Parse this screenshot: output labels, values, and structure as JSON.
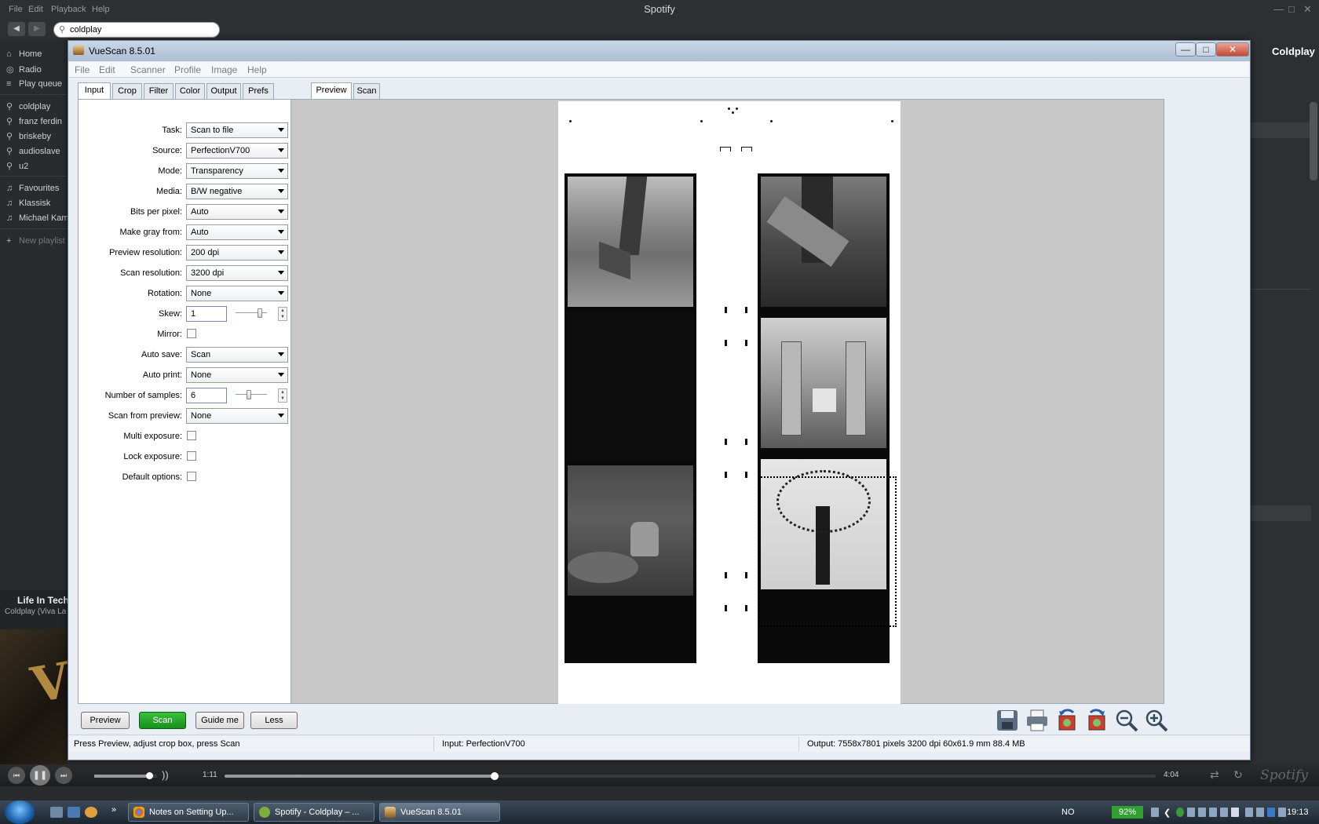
{
  "spotify": {
    "title": "Spotify",
    "menu": [
      "File",
      "Edit",
      "Playback",
      "Help"
    ],
    "search_value": "coldplay",
    "sidebar": {
      "nav": [
        "Home",
        "Radio",
        "Play queue"
      ],
      "searches": [
        "coldplay",
        "franz ferdin",
        "briskeby",
        "audioslave",
        "u2"
      ],
      "playlists": [
        "Favourites",
        "Klassisk",
        "Michael Kam"
      ],
      "new_playlist": "New playlist"
    },
    "now_playing": {
      "title": "Life In Tech",
      "artist": "Coldplay (Viva La",
      "art_text": "VI"
    },
    "artist_header": "Coldplay",
    "player": {
      "elapsed": "1:11",
      "total": "4:04",
      "progress": 0.29,
      "volume": 0.88,
      "logo": "Spotify"
    }
  },
  "vuescan": {
    "title": "VueScan 8.5.01",
    "menu": [
      "File",
      "Edit",
      "Scanner",
      "Profile",
      "Image",
      "Help"
    ],
    "left_tabs": [
      "Input",
      "Crop",
      "Filter",
      "Color",
      "Output",
      "Prefs"
    ],
    "active_left_tab": "Input",
    "right_tabs": [
      "Preview",
      "Scan"
    ],
    "active_right_tab": "Preview",
    "fields": {
      "task": {
        "label": "Task:",
        "value": "Scan to file"
      },
      "source": {
        "label": "Source:",
        "value": "PerfectionV700"
      },
      "mode": {
        "label": "Mode:",
        "value": "Transparency"
      },
      "media": {
        "label": "Media:",
        "value": "B/W negative"
      },
      "bits_per_pixel": {
        "label": "Bits per pixel:",
        "value": "Auto"
      },
      "make_gray_from": {
        "label": "Make gray from:",
        "value": "Auto"
      },
      "preview_resolution": {
        "label": "Preview resolution:",
        "value": "200 dpi"
      },
      "scan_resolution": {
        "label": "Scan resolution:",
        "value": "3200 dpi"
      },
      "rotation": {
        "label": "Rotation:",
        "value": "None"
      },
      "skew": {
        "label": "Skew:",
        "value": "1"
      },
      "mirror": {
        "label": "Mirror:",
        "checked": false
      },
      "auto_save": {
        "label": "Auto save:",
        "value": "Scan"
      },
      "auto_print": {
        "label": "Auto print:",
        "value": "None"
      },
      "number_of_samples": {
        "label": "Number of samples:",
        "value": "6"
      },
      "scan_from_preview": {
        "label": "Scan from preview:",
        "value": "None"
      },
      "multi_exposure": {
        "label": "Multi exposure:",
        "checked": false
      },
      "lock_exposure": {
        "label": "Lock exposure:",
        "checked": false
      },
      "default_options": {
        "label": "Default options:",
        "checked": false
      }
    },
    "buttons": {
      "preview": "Preview",
      "scan": "Scan",
      "guide": "Guide me",
      "less": "Less"
    },
    "toolbar_icons": [
      "save-icon",
      "print-icon",
      "rotate-left-icon",
      "rotate-right-icon",
      "zoom-out-icon",
      "zoom-in-icon"
    ],
    "status": {
      "hint": "Press Preview, adjust crop box, press Scan",
      "input": "Input: PerfectionV700",
      "output": "Output: 7558x7801 pixels 3200 dpi 60x61.9 mm 88.4 MB"
    },
    "colors": {
      "scan_button": "#16901a",
      "chrome": "#aebfd4"
    }
  },
  "taskbar": {
    "tasks": [
      "Notes on Setting Up...",
      "Spotify - Coldplay – ...",
      "VueScan 8.5.01"
    ],
    "lang": "NO",
    "battery": "92%",
    "time": "19:13",
    "overflow": "»"
  }
}
